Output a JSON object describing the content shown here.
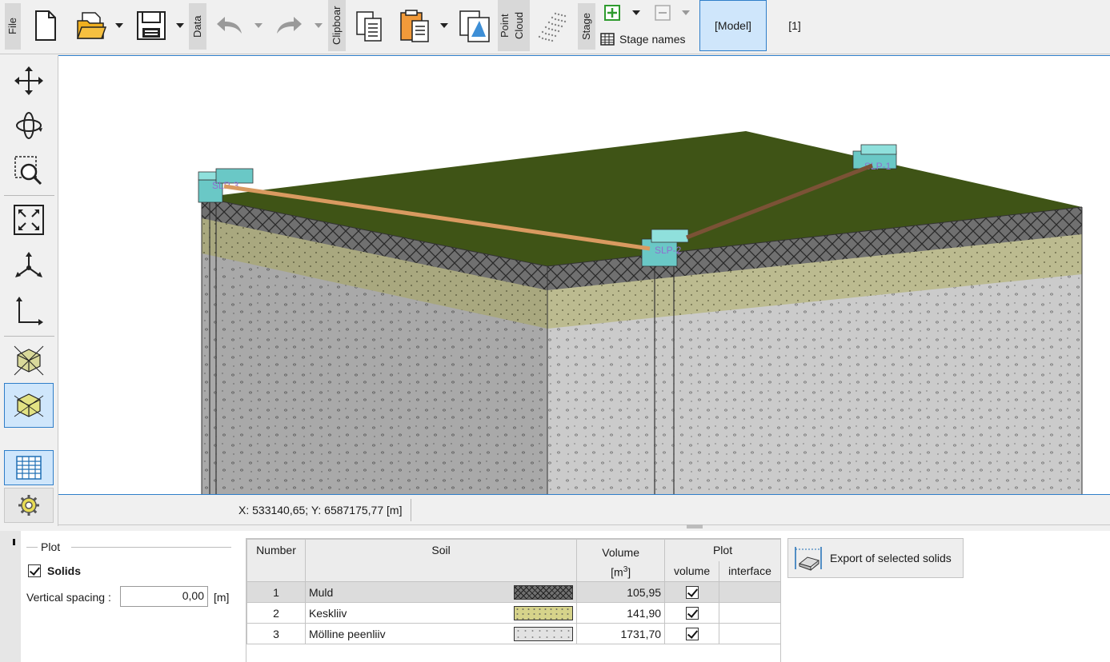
{
  "toolbar": {
    "file_label": "File",
    "data_label": "Data",
    "clipboard_label": "Clipboar",
    "pointcloud_label": "Point Cloud",
    "stage_label": "Stage",
    "stage_names_label": "Stage names",
    "model_tab": "[Model]",
    "stage1_tab": "[1]",
    "icons": [
      "new-file-icon",
      "open-folder-icon",
      "save-icon",
      "undo-icon",
      "redo-icon",
      "copy-icon",
      "paste-icon",
      "copy-view-icon",
      "point-cloud-icon",
      "add-stage-icon",
      "remove-stage-icon",
      "table-icon"
    ]
  },
  "left_tools": [
    "move-icon",
    "rotate-icon",
    "zoom-window-icon",
    "zoom-extents-icon",
    "axes-icon",
    "coordinate-system-icon",
    "wireframe-cube-icon",
    "solid-cube-icon",
    "table-view-icon",
    "settings-gear-icon"
  ],
  "viewport": {
    "borehole_labels": [
      "SLP-3",
      "SLP-2",
      "SLP-1"
    ],
    "layer_colors": {
      "top": "#3f5416",
      "muld": "#6c6c6c",
      "keskliiv": "#b9b88e",
      "peenliiv": "#c9c9c9"
    }
  },
  "status": {
    "coordinates": "X: 533140,65; Y: 6587175,77 [m]"
  },
  "plot_panel": {
    "group_label": "Plot",
    "solids_label": "Solids",
    "solids_checked": true,
    "vertical_spacing_label": "Vertical spacing :",
    "vertical_spacing_value": "0,00",
    "unit": "[m]"
  },
  "table": {
    "headers": {
      "number": "Number",
      "soil": "Soil",
      "volume": "Volume",
      "volume_unit": "[m",
      "volume_unit_sup": "3",
      "volume_unit_end": "]",
      "plot": "Plot",
      "plot_volume": "volume",
      "plot_interface": "interface"
    },
    "rows": [
      {
        "number": "1",
        "soil": "Muld",
        "volume": "105,95",
        "plot_volume": true,
        "pattern": "muld"
      },
      {
        "number": "2",
        "soil": "Keskliiv",
        "volume": "141,90",
        "plot_volume": true,
        "pattern": "keskliiv"
      },
      {
        "number": "3",
        "soil": "Mölline peenliiv",
        "volume": "1731,70",
        "plot_volume": true,
        "pattern": "peenliiv"
      }
    ]
  },
  "export_button": "Export of selected solids"
}
